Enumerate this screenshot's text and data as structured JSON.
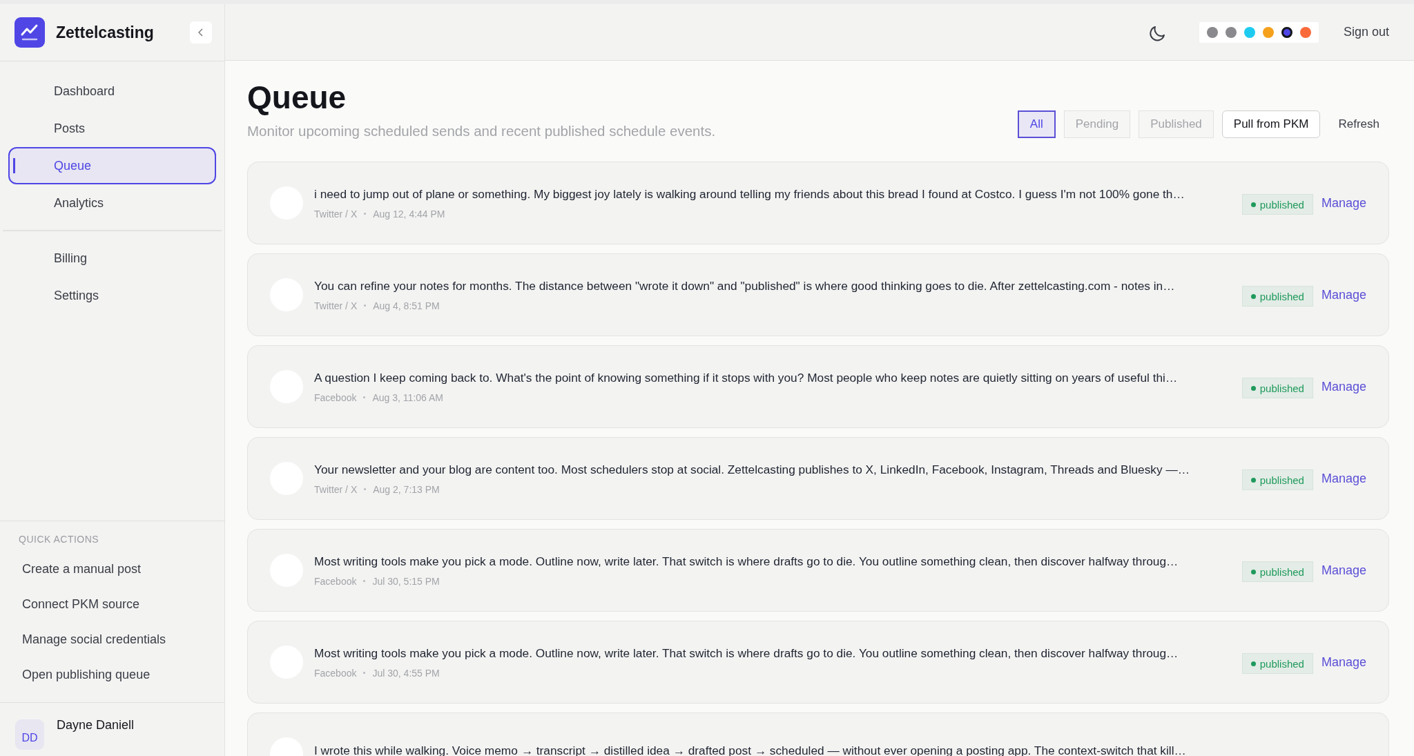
{
  "brand": {
    "name": "Zettelcasting"
  },
  "nav": [
    {
      "label": "Dashboard",
      "selected": false
    },
    {
      "label": "Posts",
      "selected": false
    },
    {
      "label": "Queue",
      "selected": true
    },
    {
      "label": "Analytics",
      "selected": false
    }
  ],
  "nav_secondary": [
    {
      "label": "Billing",
      "selected": false
    },
    {
      "label": "Settings",
      "selected": false
    }
  ],
  "quick_actions": {
    "title": "QUICK ACTIONS",
    "items": [
      "Create a manual post",
      "Connect PKM source",
      "Manage social credentials",
      "Open publishing queue"
    ]
  },
  "user": {
    "initials": "DD",
    "name": "Dayne Daniell"
  },
  "header": {
    "themes": [
      {
        "color": "#8a8a8e",
        "selected": false
      },
      {
        "color": "#8a8a8e",
        "selected": false
      },
      {
        "color": "#1ecbf0",
        "selected": false
      },
      {
        "color": "#f5a11c",
        "selected": false
      },
      {
        "color": "#4f46e5",
        "selected": true
      },
      {
        "color": "#f96a3b",
        "selected": false
      }
    ],
    "sign_out": "Sign out"
  },
  "page": {
    "title": "Queue",
    "subtitle": "Monitor upcoming scheduled sends and recent published schedule events.",
    "filters": [
      {
        "label": "All",
        "selected": true
      },
      {
        "label": "Pending",
        "selected": false
      },
      {
        "label": "Published",
        "selected": false
      }
    ],
    "actions": [
      {
        "label": "Pull from PKM",
        "kind": "outlined"
      },
      {
        "label": "Refresh",
        "kind": "plain"
      }
    ]
  },
  "posts": [
    {
      "text": "i need to jump out of plane or something. My biggest joy lately is walking around telling my friends about this bread I found at Costco. I guess I'm not 100% gone th…",
      "platform": "Twitter / X",
      "time": "Aug 12, 4:44 PM",
      "status": "published",
      "action": "Manage"
    },
    {
      "text": "You can refine your notes for months. The distance between \"wrote it down\" and \"published\" is where good thinking goes to die. After zettelcasting.com - notes in…",
      "platform": "Twitter / X",
      "time": "Aug 4, 8:51 PM",
      "status": "published",
      "action": "Manage"
    },
    {
      "text": "A question I keep coming back to. What's the point of knowing something if it stops with you? Most people who keep notes are quietly sitting on years of useful thi…",
      "platform": "Facebook",
      "time": "Aug 3, 11:06 AM",
      "status": "published",
      "action": "Manage"
    },
    {
      "text": "Your newsletter and your blog are content too. Most schedulers stop at social. Zettelcasting publishes to X, LinkedIn, Facebook, Instagram, Threads and Bluesky —…",
      "platform": "Twitter / X",
      "time": "Aug 2, 7:13 PM",
      "status": "published",
      "action": "Manage"
    },
    {
      "text": "Most writing tools make you pick a mode. Outline now, write later. That switch is where drafts go to die. You outline something clean, then discover halfway throug…",
      "platform": "Facebook",
      "time": "Jul 30, 5:15 PM",
      "status": "published",
      "action": "Manage"
    },
    {
      "text": "Most writing tools make you pick a mode. Outline now, write later. That switch is where drafts go to die. You outline something clean, then discover halfway throug…",
      "platform": "Facebook",
      "time": "Jul 30, 4:55 PM",
      "status": "published",
      "action": "Manage"
    },
    {
      "text": "I wrote this while walking. Voice memo → transcript → distilled idea → drafted post → scheduled — without ever opening a posting app. The context-switch that kill…"
    }
  ]
}
